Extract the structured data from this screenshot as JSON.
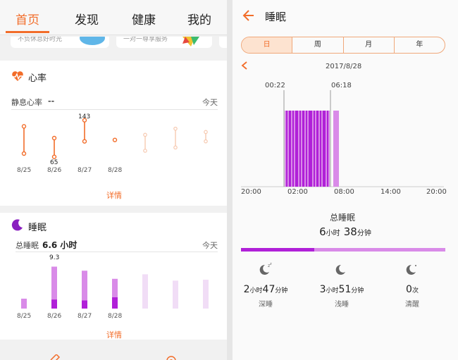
{
  "home": {
    "tabs": [
      "首页",
      "发现",
      "健康",
      "我的"
    ],
    "promo_left": "不负休息好时光",
    "promo_right": "一对一尊享服务",
    "heart": {
      "title": "心率",
      "resting_label": "静息心率",
      "resting_value": "--",
      "date_label": "今天",
      "details": "详情",
      "chart_data": {
        "type": "range",
        "categories": [
          "8/25",
          "8/26",
          "8/27",
          "8/28"
        ],
        "series": [
          {
            "category": "8/25",
            "low": 72,
            "high": 130
          },
          {
            "category": "8/26",
            "low": 65,
            "high": 105
          },
          {
            "category": "8/27",
            "low": 98,
            "high": 143
          },
          {
            "category": "8/28",
            "low": 101,
            "high": 101
          }
        ],
        "ghost_count": 3,
        "data_labels": {
          "max": "143",
          "min": "65"
        }
      }
    },
    "sleep": {
      "title": "睡眠",
      "total_label": "总睡眠",
      "total_value": "6.6 小时",
      "date_label": "今天",
      "details": "详情",
      "chart_data": {
        "type": "bar",
        "categories": [
          "8/25",
          "8/26",
          "8/27",
          "8/28"
        ],
        "values": [
          2.2,
          9.3,
          8.4,
          6.6
        ],
        "deep": [
          0,
          2.0,
          1.8,
          2.5
        ],
        "ghost_count": 3,
        "max_label": "9.3",
        "ylim": [
          0,
          10
        ]
      }
    }
  },
  "detail": {
    "title": "睡眠",
    "segments": [
      "日",
      "周",
      "月",
      "年"
    ],
    "active_segment": 0,
    "date": "2017/8/28",
    "start_marker": "00:22",
    "end_marker": "06:18",
    "axis_labels": [
      "20:00",
      "02:00",
      "08:00",
      "14:00",
      "20:00"
    ],
    "total_label": "总睡眠",
    "total_hours": "6",
    "hours_unit": "小时",
    "total_minutes": "38",
    "minutes_unit": "分钟",
    "deep_ratio": 0.36,
    "stats": [
      {
        "icon": "deep-sleep-icon",
        "h": "2",
        "h_unit": "小时",
        "m": "47",
        "m_unit": "分钟",
        "label": "深睡"
      },
      {
        "icon": "light-sleep-icon",
        "h": "3",
        "h_unit": "小时",
        "m": "51",
        "m_unit": "分钟",
        "label": "浅睡"
      },
      {
        "icon": "awake-icon",
        "h": "0",
        "h_unit": "次",
        "m": "",
        "m_unit": "",
        "label": "清醒"
      }
    ],
    "colors": {
      "deep": "#b020d8",
      "light": "#d98be8",
      "accent": "#f26d2a"
    }
  }
}
